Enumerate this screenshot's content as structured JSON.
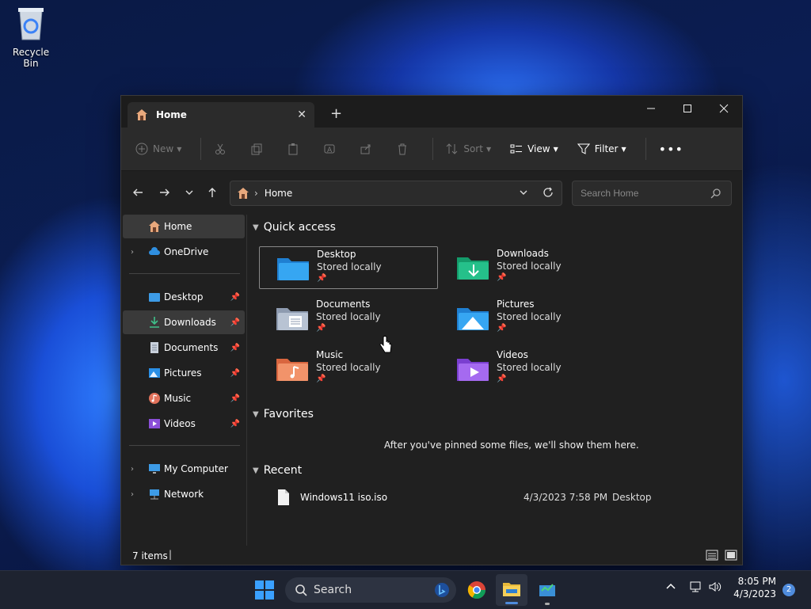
{
  "desktop": {
    "recycle_bin_label": "Recycle Bin"
  },
  "window": {
    "tab_title": "Home",
    "toolbar": {
      "new_label": "New",
      "sort_label": "Sort",
      "view_label": "View",
      "filter_label": "Filter"
    },
    "address": {
      "path_label": "Home"
    },
    "search": {
      "placeholder": "Search Home"
    },
    "sidebar": {
      "top_items": [
        {
          "label": "Home"
        },
        {
          "label": "OneDrive"
        }
      ],
      "pinned_items": [
        {
          "label": "Desktop"
        },
        {
          "label": "Downloads"
        },
        {
          "label": "Documents"
        },
        {
          "label": "Pictures"
        },
        {
          "label": "Music"
        },
        {
          "label": "Videos"
        }
      ],
      "bottom_items": [
        {
          "label": "My Computer"
        },
        {
          "label": "Network"
        }
      ]
    },
    "quick_access": {
      "title": "Quick access",
      "items": [
        {
          "name": "Desktop",
          "status": "Stored locally"
        },
        {
          "name": "Downloads",
          "status": "Stored locally"
        },
        {
          "name": "Documents",
          "status": "Stored locally"
        },
        {
          "name": "Pictures",
          "status": "Stored locally"
        },
        {
          "name": "Music",
          "status": "Stored locally"
        },
        {
          "name": "Videos",
          "status": "Stored locally"
        }
      ]
    },
    "favorites": {
      "title": "Favorites",
      "empty_text": "After you've pinned some files, we'll show them here."
    },
    "recent": {
      "title": "Recent",
      "items": [
        {
          "name": "Windows11 iso.iso",
          "date": "4/3/2023 7:58 PM",
          "location": "Desktop"
        }
      ]
    },
    "status": {
      "item_count": "7 items"
    }
  },
  "taskbar": {
    "search_label": "Search",
    "time": "8:05 PM",
    "date": "4/3/2023",
    "notification_count": "2"
  },
  "colors": {
    "accent": "#4f8bdc",
    "window_bg": "#202020",
    "toolbar_bg": "#2b2b2b"
  }
}
